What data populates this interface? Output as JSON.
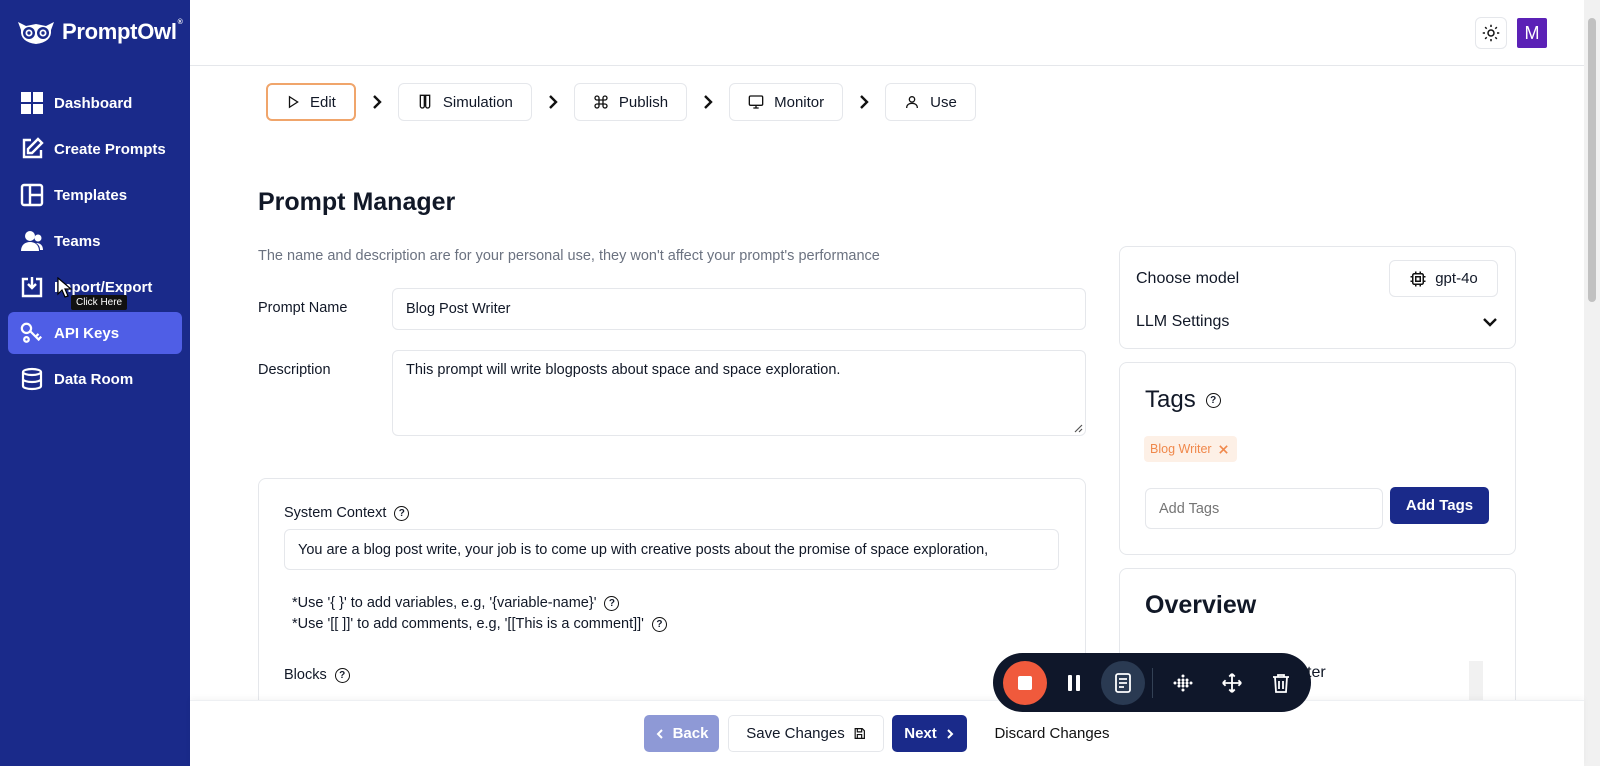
{
  "app": {
    "name": "PromptOwl",
    "trademark": "®"
  },
  "sidebar": {
    "items": [
      {
        "label": "Dashboard",
        "icon": "grid-icon"
      },
      {
        "label": "Create Prompts",
        "icon": "edit-icon"
      },
      {
        "label": "Templates",
        "icon": "layout-icon"
      },
      {
        "label": "Teams",
        "icon": "users-icon"
      },
      {
        "label": "Import/Export",
        "icon": "import-icon"
      },
      {
        "label": "API Keys",
        "icon": "key-icon",
        "active": true
      },
      {
        "label": "Data Room",
        "icon": "database-icon"
      }
    ],
    "tooltip": "Click Here"
  },
  "topbar": {
    "avatar_initial": "M"
  },
  "steps": [
    {
      "label": "Edit",
      "active": true
    },
    {
      "label": "Simulation"
    },
    {
      "label": "Publish"
    },
    {
      "label": "Monitor"
    },
    {
      "label": "Use"
    }
  ],
  "main": {
    "title": "Prompt Manager",
    "subtitle": "The name and description are for your personal use, they won't affect your prompt's performance",
    "prompt_name_label": "Prompt Name",
    "prompt_name_value": "Blog Post Writer",
    "description_label": "Description",
    "description_value": "This prompt will write blogposts about space and space exploration.",
    "system_context_label": "System Context",
    "system_context_value": "You are a blog post write, your job is to come up with creative posts about the promise of space exploration,",
    "hint_variables": "*Use '{ }' to add variables, e.g, '{variable-name}'",
    "hint_comments": "*Use '[[ ]]' to add comments, e.g, '[[This is a comment]]'",
    "blocks_label": "Blocks"
  },
  "right": {
    "choose_model_label": "Choose model",
    "model_value": "gpt-4o",
    "llm_settings_label": "LLM Settings",
    "tags_title": "Tags",
    "tags": [
      "Blog Writer"
    ],
    "add_tags_placeholder": "Add Tags",
    "add_tags_button": "Add Tags",
    "overview_title": "Overview",
    "overview_partial": "ter"
  },
  "bottom": {
    "back": "Back",
    "save": "Save Changes",
    "next": "Next",
    "discard": "Discard Changes"
  },
  "colors": {
    "sidebar_bg": "#1a2a8a",
    "active_nav": "#4f5ee6",
    "accent_orange": "#f0a56b",
    "recorder_stop": "#f05a3c"
  }
}
